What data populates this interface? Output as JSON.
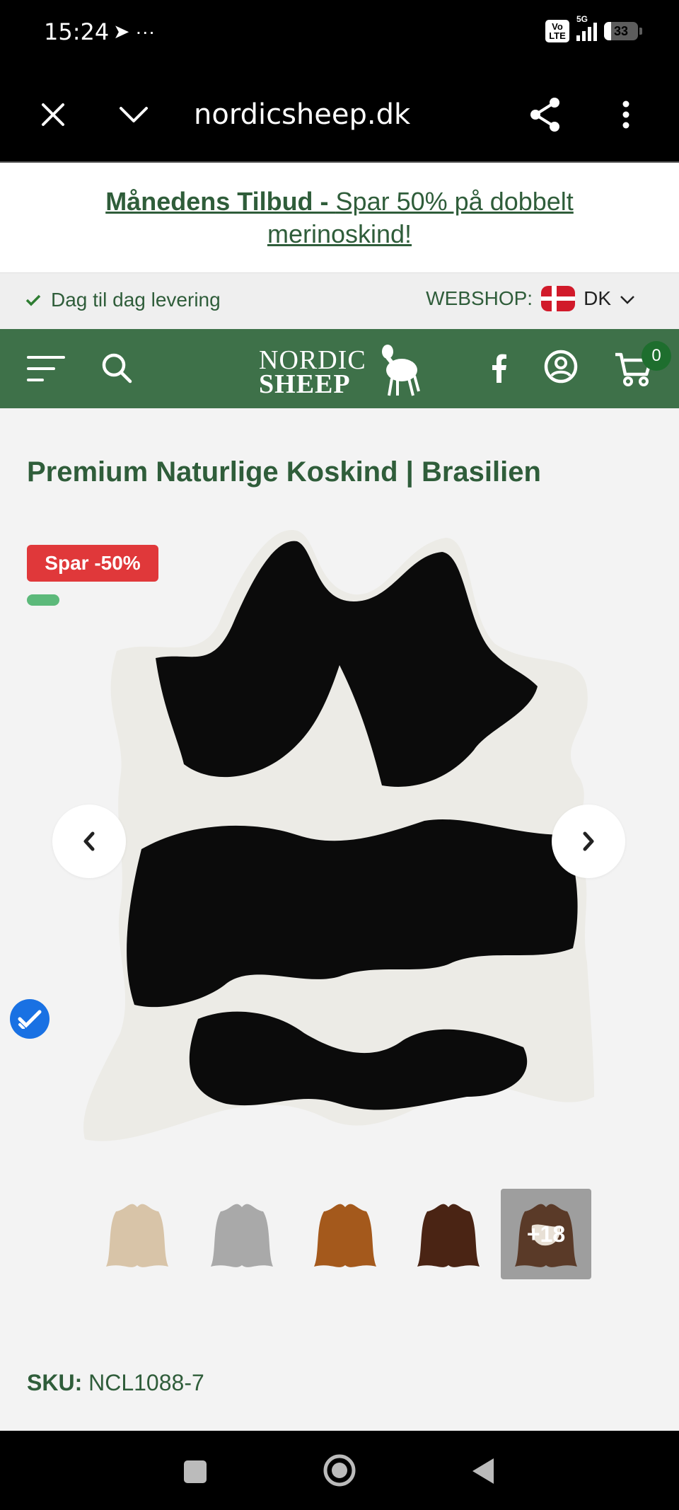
{
  "status_bar": {
    "time": "15:24",
    "extra": "➤ ···",
    "network": "5G",
    "volte": "Vo LTE",
    "battery": "33"
  },
  "browser": {
    "url": "nordicsheep.dk"
  },
  "promo": {
    "bold_part": "Månedens Tilbud - ",
    "rest": "Spar 50% på dobbelt merinoskind!"
  },
  "info_bar": {
    "delivery": "Dag til dag levering",
    "webshop_label": "WEBSHOP:",
    "country": "DK"
  },
  "header": {
    "logo_line1": "NORDIC",
    "logo_line2": "SHEEP",
    "cart_count": "0"
  },
  "product": {
    "title": "Premium Naturlige Koskind | Brasilien",
    "discount_badge": "Spar -50%",
    "more_count": "+18",
    "sku_label": "SKU:",
    "sku_value": "NCL1088-7"
  },
  "colors": {
    "brand_green": "#3e7149",
    "text_green": "#2f5d3a",
    "badge_red": "#e0383a"
  },
  "icons": [
    "close-icon",
    "chevron-down-icon",
    "share-icon",
    "more-vert-icon",
    "check-icon",
    "flag-dk-icon",
    "menu-icon",
    "search-icon",
    "facebook-icon",
    "account-icon",
    "cart-icon",
    "chevron-left-icon",
    "chevron-right-icon",
    "verified-icon"
  ]
}
